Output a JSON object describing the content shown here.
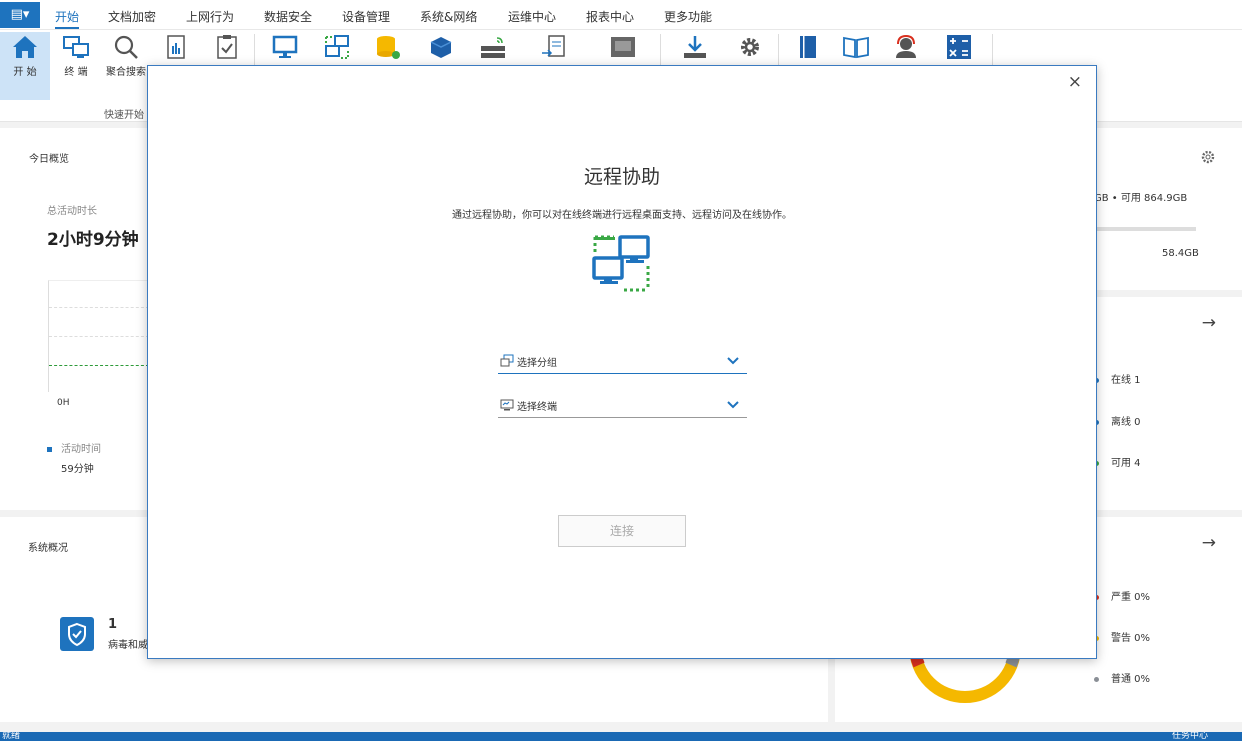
{
  "menu": {
    "app_icon": "menu-icon",
    "tabs": [
      "开始",
      "文档加密",
      "上网行为",
      "数据安全",
      "设备管理",
      "系统&网络",
      "运维中心",
      "报表中心",
      "更多功能"
    ],
    "active_tab": "开始"
  },
  "ribbon": {
    "buttons": [
      {
        "icon": "home-icon",
        "label": "开 始"
      },
      {
        "icon": "terminal-icon",
        "label": "终 端"
      },
      {
        "icon": "search-icon",
        "label": "聚合搜索"
      }
    ],
    "group_label": "快速开始"
  },
  "dashboard": {
    "today_title": "今日概览",
    "total_active_label": "总活动时长",
    "total_active_value": "2小时9分钟",
    "chart_axis_label": "0H",
    "legend_label": "活动时间",
    "legend_value": "59分钟",
    "system_title": "系统概况",
    "virus_count": "1",
    "virus_label": "病毒和威",
    "disk_free": "GB • 可用 864.9GB",
    "disk_value": "58.4GB",
    "status": {
      "online": "在线 1",
      "offline": "离线 0",
      "available": "可用 4"
    },
    "alerts": {
      "serious": "严重 0%",
      "warning": "警告 0%",
      "normal": "普通 0%"
    }
  },
  "dialog": {
    "title": "远程协助",
    "description": "通过远程协助，你可以对在线终端进行远程桌面支持、远程访问及在线协作。",
    "group_placeholder": "选择分组",
    "terminal_placeholder": "选择终端",
    "connect_label": "连接",
    "close_label": "×"
  },
  "statusbar": {
    "left": "就绪",
    "right": "任务中心"
  },
  "colors": {
    "accent": "#1e73be",
    "green_dash": "#2e9b3a",
    "ring_yellow": "#f5b800",
    "ring_red": "#d9301f",
    "ring_gray": "#8a8f96"
  }
}
